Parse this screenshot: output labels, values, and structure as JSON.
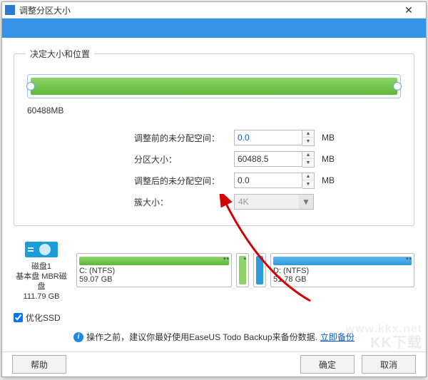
{
  "titlebar": {
    "title": "调整分区大小"
  },
  "header": {},
  "group": {
    "legend": "决定大小和位置"
  },
  "bar": {
    "size_label": "60488MB"
  },
  "form": {
    "before": {
      "label": "调整前的未分配空间：",
      "value": "0.0",
      "unit": "MB"
    },
    "size": {
      "label": "分区大小：",
      "value": "60488.5",
      "unit": "MB"
    },
    "after": {
      "label": "调整后的未分配空间：",
      "value": "0.0",
      "unit": "MB"
    },
    "cluster": {
      "label": "簇大小：",
      "value": "4K"
    }
  },
  "disk": {
    "name": "磁盘1",
    "type": "基本盘 MBR磁盘",
    "total": "111.79 GB",
    "parts": [
      {
        "label": "C: (NTFS)",
        "size": "59.07 GB"
      },
      {
        "label": "",
        "size": ""
      },
      {
        "label": "",
        "size": ""
      },
      {
        "label": "D: (NTFS)",
        "size": "51.78 GB"
      }
    ]
  },
  "ssd": {
    "label": "优化SSD",
    "checked": true
  },
  "tip": {
    "text": "操作之前，建议你最好使用EaseUS Todo Backup来备份数据.",
    "link": "立即备份"
  },
  "buttons": {
    "help": "帮助",
    "ok": "确定",
    "cancel": "取消"
  },
  "watermark": {
    "a": "KK下载",
    "b": "www.kkx.net"
  }
}
